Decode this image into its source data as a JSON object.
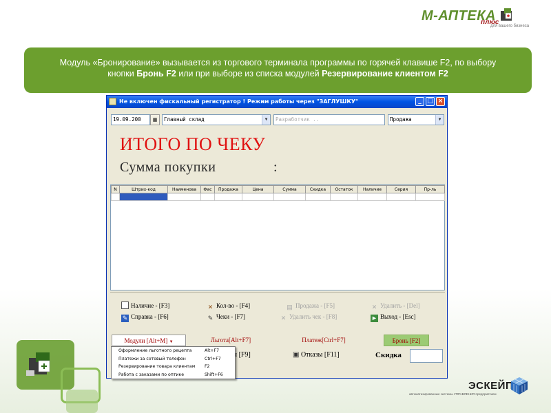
{
  "logo_top": {
    "name": "М-АПТЕКА",
    "plus": "плюс",
    "tagline": "для вашего бизнеса"
  },
  "banner": {
    "line1": "Модуль «Бронирование» вызывается из торгового терминала программы по горячей клавише F2, по выбору",
    "line2_prefix": "кнопки ",
    "line2_bold1": "Бронь F2",
    "line2_mid": " или при выборе из списка модулей ",
    "line2_bold2": "Резервирование клиентом F2"
  },
  "window": {
    "title": "Не включен фискальный регистратор !  Режим работы через \"ЗАГЛУШКУ\"",
    "date": "19.09.200",
    "warehouse": "Главный склад",
    "developer_placeholder": "Разработчик ..",
    "mode": "Продажа",
    "total_title": "ИТОГО ПО ЧЕКУ",
    "total_sub": "Сумма  покупки",
    "total_colon": ":"
  },
  "grid": {
    "columns": [
      "N",
      "Штрих-код",
      "Наименова",
      "Фас",
      "Продажа",
      "Цена",
      "Сумма",
      "Скидка",
      "Остаток",
      "Наличие",
      "Серия",
      "Пр-ль"
    ]
  },
  "functions": {
    "cash": "Наличие - [F3]",
    "qty": "Кол-во - [F4]",
    "sale": "Продажа - [F5]",
    "delete": "Удалить - [Del]",
    "help": "Справка - [F6]",
    "checks": "Чеки - [F7]",
    "delete_check": "Удалить чек - [F8]",
    "exit": "Выход - [Esc]"
  },
  "tabs": {
    "modules": "Модули [Alt+M]",
    "benefit": "Льгота[Alt+F7]",
    "payment": "Платеж[Ctrl+F7]",
    "booking": "Бронь [F2]"
  },
  "bottom": {
    "hidden_btn": "ач [F9]",
    "refusals": "Отказы [F11]",
    "discount_label": "Скидка"
  },
  "dropdown": {
    "items": [
      {
        "label": "Оформление льготного рецепта",
        "shortcut": "Alt+F7"
      },
      {
        "label": "Платежи за сотовый телефон",
        "shortcut": "Ctrl+F7"
      },
      {
        "label": "Резервирование товара клиентам",
        "shortcut": "F2"
      },
      {
        "label": "Работа с заказами по оптике",
        "shortcut": "Shift+F6"
      }
    ]
  },
  "logo_bottom": {
    "name": "ЭСКЕЙП",
    "tagline": "автоматизированные системы УПРАВЛЕНИЯ предприятием"
  },
  "colors": {
    "banner": "#6c9f2e",
    "total_red": "#e01010",
    "title_blue": "#0054e3"
  }
}
